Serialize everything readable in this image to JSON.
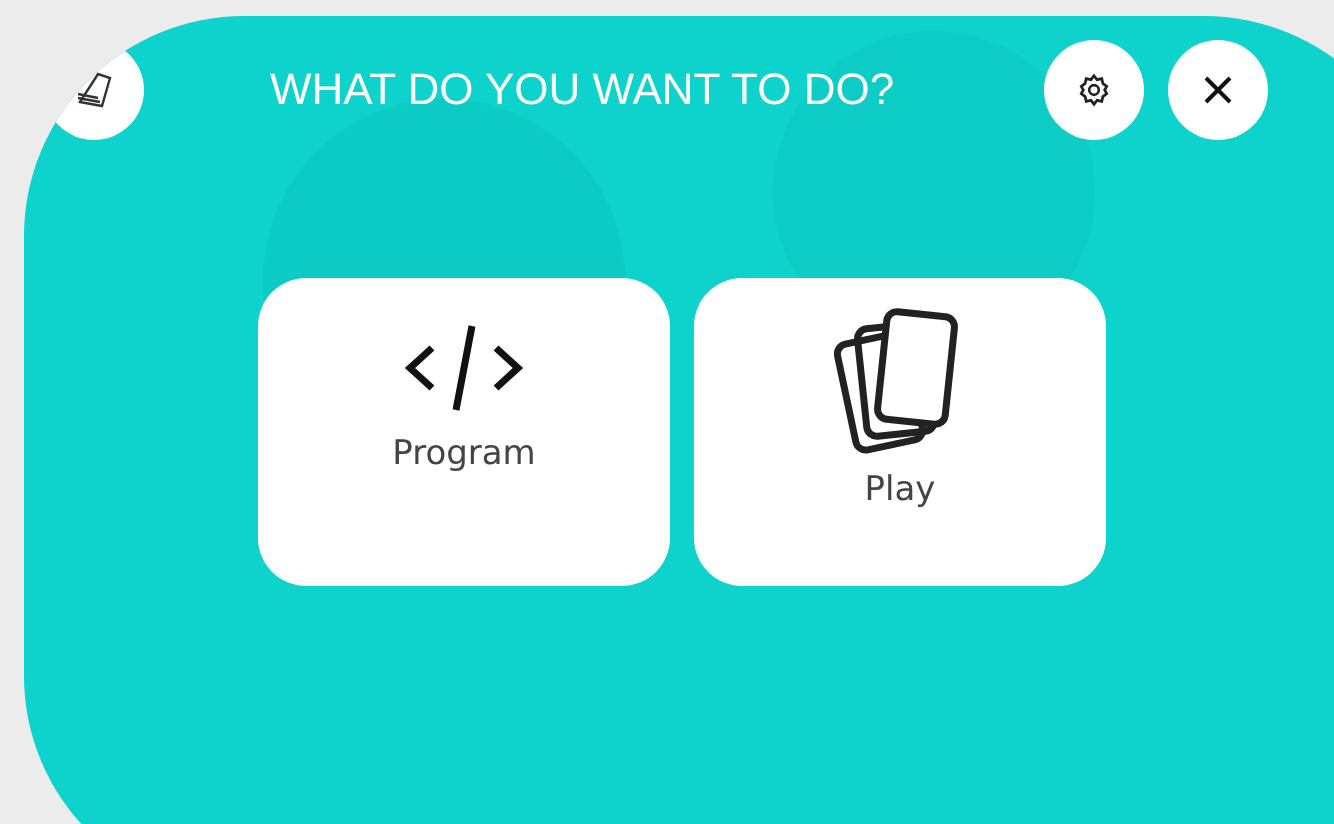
{
  "title": "WHAT DO YOU WANT TO DO?",
  "options": [
    {
      "kind": "code",
      "label": "Program"
    },
    {
      "kind": "cards",
      "label": "Play"
    }
  ]
}
